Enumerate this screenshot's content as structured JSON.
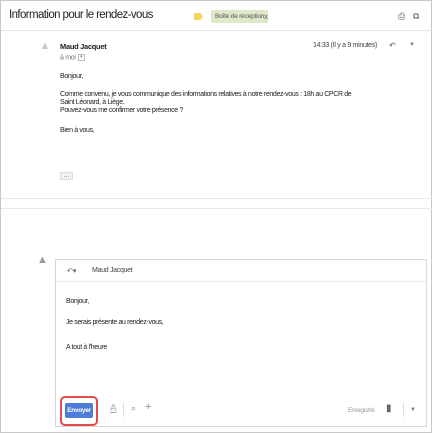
{
  "thread": {
    "subject": "Information pour le rendez-vous",
    "label": "Boîte de réception",
    "label_close": "x",
    "icons": {
      "important": "important-marker-icon",
      "print": "print-icon",
      "new_window": "new-window-icon"
    }
  },
  "message": {
    "sender": "Maud Jacquet",
    "to": "à moi",
    "date": "14:33 (Il y a 9 minutes)",
    "body": [
      "Bonjour,",
      "Comme convenu, je vous communique des informations relatives à notre rendez-vous : 18h au CPCR de",
      "Saint Léonard, à Liège.",
      "Pouvez-vous me confirmer votre présence ?",
      "Bien à vous,"
    ],
    "ellipsis": "...",
    "icons": {
      "star": "star-icon",
      "reply": "reply-icon",
      "more": "more-options-icon"
    }
  },
  "reply": {
    "recipient": "Maud Jacquet",
    "body": [
      "Bonjour,",
      "Je serais présente au rendez-vous,",
      "A tout à l'heure"
    ],
    "send_label": "Envoyer",
    "saved_label": "Enregistré",
    "accent_color": "#4d7dd6",
    "highlight_color": "#e14b4b"
  }
}
